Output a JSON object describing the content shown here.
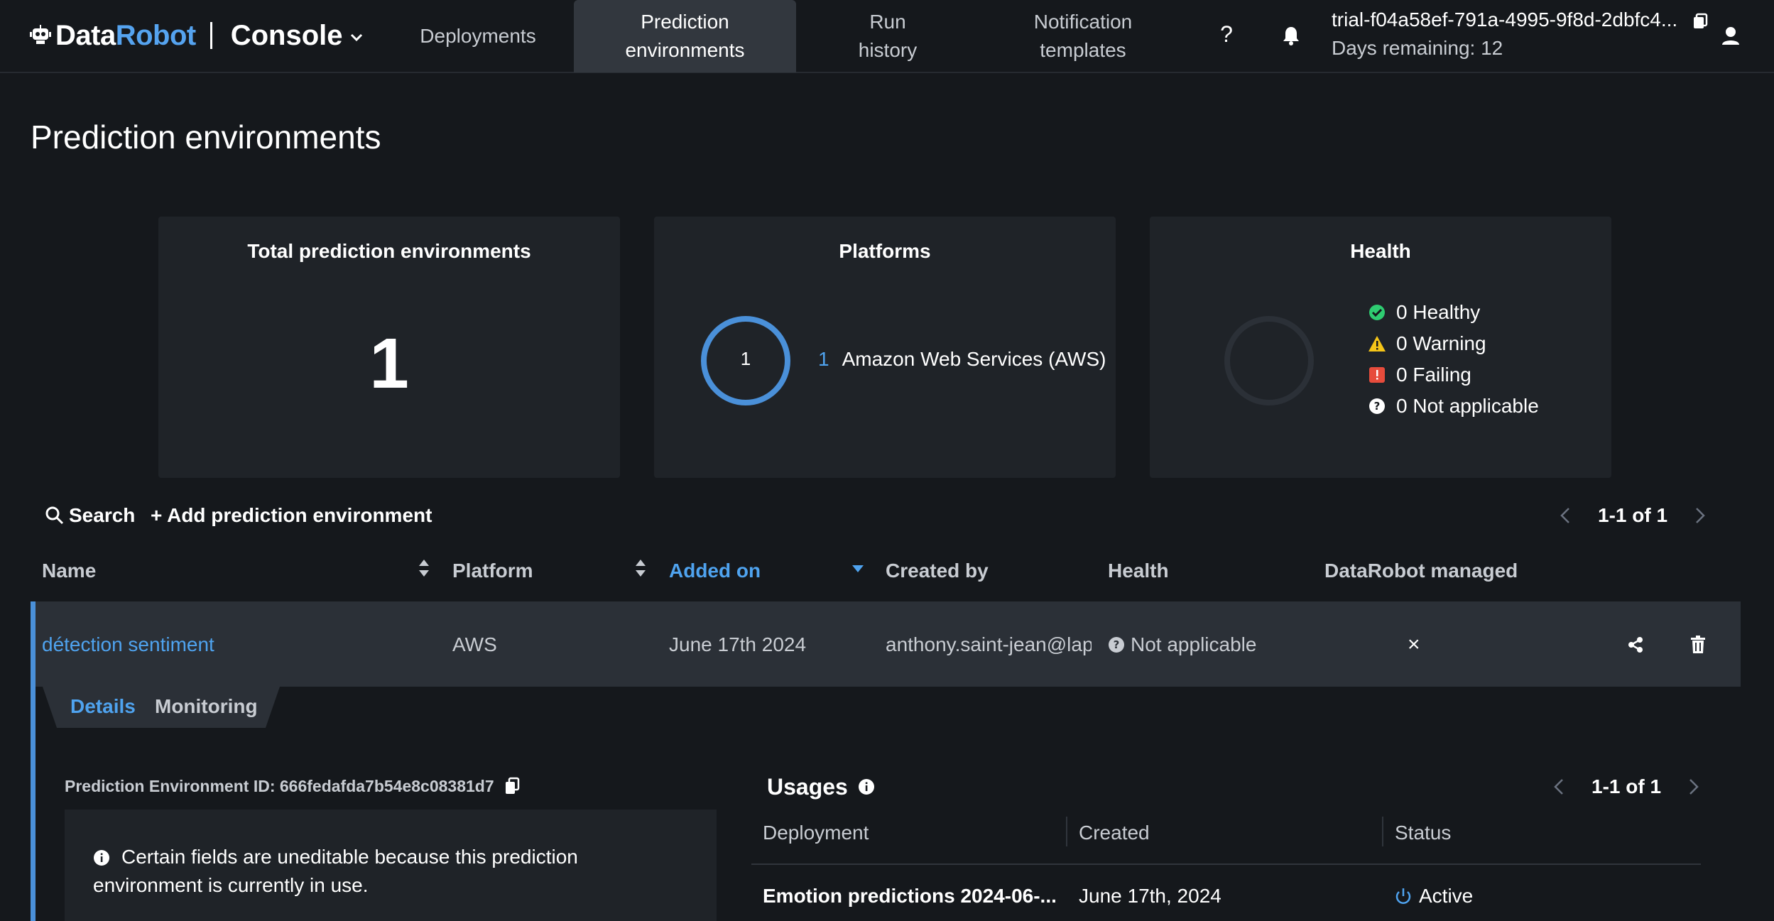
{
  "brand": {
    "name_a": "Data",
    "name_b": "Robot",
    "section": "Console"
  },
  "nav": {
    "deployments": "Deployments",
    "prediction_env_line1": "Prediction",
    "prediction_env_line2": "environments",
    "run_history_line1": "Run",
    "run_history_line2": "history",
    "notification_line1": "Notification",
    "notification_line2": "templates",
    "help": "?"
  },
  "account": {
    "trial_id": "trial-f04a58ef-791a-4995-9f8d-2dbfc4...",
    "days_remaining": "Days remaining: 12"
  },
  "page": {
    "title": "Prediction environments"
  },
  "cards": {
    "total": {
      "title": "Total prediction environments",
      "value": "1"
    },
    "platforms": {
      "title": "Platforms",
      "ring_value": "1",
      "items": [
        {
          "count": "1",
          "label": "Amazon Web Services (AWS)"
        }
      ]
    },
    "health": {
      "title": "Health",
      "items": [
        {
          "label": "0 Healthy",
          "color": "#2ecc71"
        },
        {
          "label": "0 Warning",
          "color": "#f5c518"
        },
        {
          "label": "0 Failing",
          "color": "#e74c3c"
        },
        {
          "label": "0 Not applicable",
          "color": "#ffffff"
        }
      ]
    }
  },
  "toolbar": {
    "search": "Search",
    "add": "+ Add prediction environment",
    "pager": "1-1 of 1"
  },
  "table": {
    "headers": {
      "name": "Name",
      "platform": "Platform",
      "added_on": "Added on",
      "created_by": "Created by",
      "health": "Health",
      "managed": "DataRobot managed"
    },
    "rows": [
      {
        "name": "détection sentiment",
        "platform": "AWS",
        "added_on": "June 17th 2024",
        "created_by": "anthony.saint-jean@lap",
        "health": "Not applicable",
        "managed": "×"
      }
    ]
  },
  "details": {
    "tabs": {
      "details": "Details",
      "monitoring": "Monitoring"
    },
    "env_id": "Prediction Environment ID: 666fedafda7b54e8c08381d7",
    "info": "Certain fields are uneditable because this prediction environment is currently in use."
  },
  "usages": {
    "title": "Usages",
    "pager": "1-1 of 1",
    "headers": {
      "deployment": "Deployment",
      "created": "Created",
      "status": "Status"
    },
    "rows": [
      {
        "deployment": "Emotion predictions 2024-06-...",
        "created": "June 17th, 2024",
        "status": "Active"
      }
    ]
  },
  "colors": {
    "accent": "#4fa3ef",
    "background": "#15181c",
    "card": "#1f2328",
    "row": "#2b3037"
  }
}
